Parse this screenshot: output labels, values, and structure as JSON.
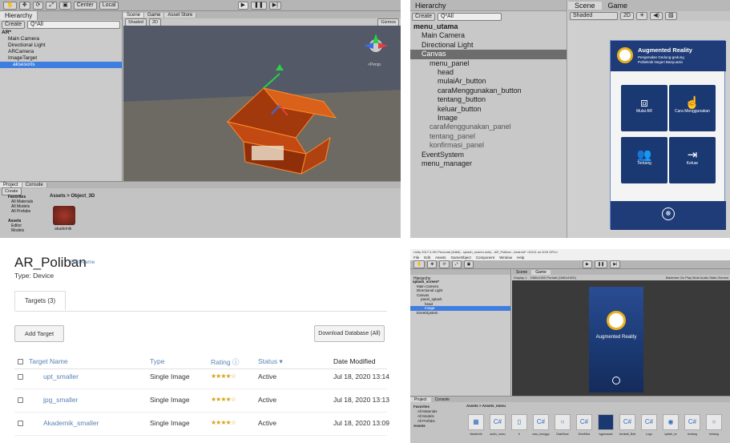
{
  "q1": {
    "toolbar": {
      "center": "Center",
      "local": "Local"
    },
    "hierarchy": {
      "tab": "Hierarchy",
      "create": "Create",
      "search": "Q*All",
      "rows": [
        "AR*",
        "Main Camera",
        "Directional Light",
        "ARCamera",
        "ImageTarget",
        "aksesoris"
      ]
    },
    "scene": {
      "tabs": [
        "Scene",
        "Game",
        "Asset Store"
      ],
      "shaded": "Shaded",
      "twod": "2D",
      "gizmos": "Gizmos",
      "persp": "<Persp"
    },
    "project": {
      "tabs": [
        "Project",
        "Console"
      ],
      "create": "Create",
      "breadcrumb": "Assets > Object_3D",
      "tree": [
        "Favorites",
        "All Materials",
        "All Models",
        "All Prefabs",
        "Assets",
        "Editor",
        "Models"
      ],
      "asset_label": "akademik"
    },
    "colors": {
      "model": "#e06a1c",
      "sky": "#4f5563",
      "ground": "#6c6a63"
    }
  },
  "q2": {
    "hierarchy": {
      "tab": "Hierarchy",
      "create": "Create",
      "search": "Q*All",
      "rows": [
        {
          "label": "menu_utama",
          "indent": 0,
          "bold": true
        },
        {
          "label": "Main Camera",
          "indent": 1
        },
        {
          "label": "Directional Light",
          "indent": 1
        },
        {
          "label": "Canvas",
          "indent": 1,
          "sel": true
        },
        {
          "label": "menu_panel",
          "indent": 2
        },
        {
          "label": "head",
          "indent": 3
        },
        {
          "label": "mulaiAr_button",
          "indent": 3
        },
        {
          "label": "caraMenggunakan_button",
          "indent": 3
        },
        {
          "label": "tentang_button",
          "indent": 3
        },
        {
          "label": "keluar_button",
          "indent": 3
        },
        {
          "label": "Image",
          "indent": 3
        },
        {
          "label": "caraMenggunakan_panel",
          "indent": 2,
          "dim": true
        },
        {
          "label": "tentang_panel",
          "indent": 2,
          "dim": true
        },
        {
          "label": "konfirmasi_panel",
          "indent": 2,
          "dim": true
        },
        {
          "label": "EventSystem",
          "indent": 1
        },
        {
          "label": "menu_manager",
          "indent": 1
        }
      ]
    },
    "scene": {
      "tabs": [
        "Scene",
        "Game"
      ],
      "shaded": "Shaded",
      "twod": "2D",
      "app_title": "Augmented Reality",
      "app_sub1": "Pengenalan Gedung-gedung",
      "app_sub2": "Politeknik Negeri Banyuasin",
      "tiles": [
        "Mulai AR",
        "Cara Menggunakan",
        "Tentang",
        "Keluar"
      ]
    },
    "colors": {
      "navy": "#1a3872",
      "panel": "#1f3c78",
      "bg": "#d3d3d3"
    }
  },
  "q3": {
    "title": "AR_Poliban",
    "edit_name": "Edit Name",
    "type": "Type: Device",
    "tab_label": "Targets (3)",
    "add_target": "Add Target",
    "download": "Download Database (All)",
    "headers": {
      "name": "Target Name",
      "type": "Type",
      "rating": "Rating ⓘ",
      "status": "Status ▾",
      "date": "Date Modified"
    },
    "rows": [
      {
        "name": "upt_smaller",
        "type": "Single Image",
        "rating": 4,
        "status": "Active",
        "date": "Jul 18, 2020 13:14"
      },
      {
        "name": "jpg_smaller",
        "type": "Single Image",
        "rating": 4,
        "status": "Active",
        "date": "Jul 18, 2020 13:13"
      },
      {
        "name": "Akademik_smaller",
        "type": "Single Image",
        "rating": 4,
        "status": "Active",
        "date": "Jul 18, 2020 13:09"
      }
    ]
  },
  "q4": {
    "title_bar": "Unity 2017.4.0f1 Personal (64bit) - splash_screen.unity - AR_Poliban - Android* <DX11 on DX9 GPU>",
    "menu": [
      "File",
      "Edit",
      "Assets",
      "GameObject",
      "Component",
      "Window",
      "Help"
    ],
    "hierarchy": {
      "tab": "Hierarchy",
      "rows": [
        "splash_screen*",
        "Main Camera",
        "Directional Light",
        "Canvas",
        "panel_splash",
        "head",
        "Image",
        "EventSystem"
      ]
    },
    "game": {
      "tabs": [
        "Scene",
        "Game"
      ],
      "display": "Display 1",
      "res": "1080x1920 Portrait (1080x1920)",
      "options": "Maximize On Play  Mute Audio  Stats  Gizmos",
      "app_title": "Augmented Reality"
    },
    "project": {
      "tabs": [
        "Project",
        "Console"
      ],
      "breadcrumb": "Assets > Assets_menu",
      "tree": [
        "Favorites",
        "All Materials",
        "All Models",
        "All Prefabs",
        "Assets"
      ],
      "assets": [
        "Akademik",
        "audio_manu",
        "b",
        "cara_menggu",
        "DashBoar",
        "DineMine",
        "bgpesawat",
        "kembali_Butt",
        "Logo",
        "splash_sc",
        "tentang",
        "tentang"
      ]
    },
    "colors": {
      "phone": "#1a3872",
      "dark": "#3a3a3a"
    }
  }
}
